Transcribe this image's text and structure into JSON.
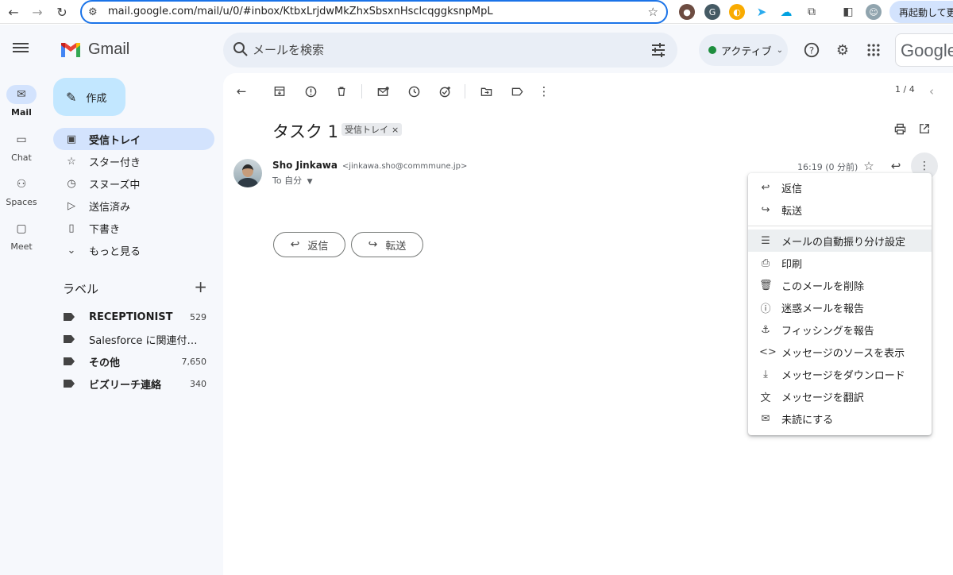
{
  "browser": {
    "url": "mail.google.com/mail/u/0/#inbox/KtbxLrjdwMkZhxSbsxnHsclcqggksnpMpL",
    "restart_label": "再起動して更新"
  },
  "rail": [
    {
      "label": "Mail",
      "icon": "mail-icon"
    },
    {
      "label": "Chat",
      "icon": "chat-icon"
    },
    {
      "label": "Spaces",
      "icon": "spaces-icon"
    },
    {
      "label": "Meet",
      "icon": "meet-icon"
    }
  ],
  "header": {
    "logo_text": "Gmail",
    "search_placeholder": "メールを検索",
    "status": "アクティブ",
    "account_brand": "Google"
  },
  "sidebar": {
    "compose": "作成",
    "items": [
      {
        "label": "受信トレイ",
        "icon": "inbox-icon"
      },
      {
        "label": "スター付き",
        "icon": "star-icon"
      },
      {
        "label": "スヌーズ中",
        "icon": "clock-icon"
      },
      {
        "label": "送信済み",
        "icon": "send-icon"
      },
      {
        "label": "下書き",
        "icon": "draft-icon"
      },
      {
        "label": "もっと見る",
        "icon": "expand-icon"
      }
    ],
    "labels_title": "ラベル",
    "labels": [
      {
        "name": "RECEPTIONIST",
        "count": "529"
      },
      {
        "name": "Salesforce に関連付けら…",
        "count": ""
      },
      {
        "name": "その他",
        "count": "7,650"
      },
      {
        "name": "ビズリーチ連絡",
        "count": "340"
      }
    ]
  },
  "message": {
    "pager": "1 / 4",
    "subject": "タスク 1",
    "chip": "受信トレイ",
    "chip_close": "×",
    "sender_name": "Sho Jinkawa",
    "sender_email": "<jinkawa.sho@commmune.jp>",
    "to": "To 自分",
    "time": "16:19 (0 分前)",
    "reply_button": "返信",
    "forward_button": "転送"
  },
  "menu": {
    "items": [
      {
        "label": "返信",
        "icon": "reply-icon"
      },
      {
        "label": "転送",
        "icon": "forward-icon"
      },
      {
        "label": "メールの自動振り分け設定",
        "icon": "filter-icon"
      },
      {
        "label": "印刷",
        "icon": "print-icon"
      },
      {
        "label": "このメールを削除",
        "icon": "trash-icon"
      },
      {
        "label": "迷惑メールを報告",
        "icon": "spam-icon"
      },
      {
        "label": "フィッシングを報告",
        "icon": "phishing-icon"
      },
      {
        "label": "メッセージのソースを表示",
        "icon": "code-icon"
      },
      {
        "label": "メッセージをダウンロード",
        "icon": "download-icon"
      },
      {
        "label": "メッセージを翻訳",
        "icon": "translate-icon"
      },
      {
        "label": "未読にする",
        "icon": "mark-unread-icon"
      }
    ]
  },
  "colors": {
    "accent": "#1a73e8",
    "compose_bg": "#c2e7ff",
    "active_nav": "#d3e3fd",
    "status_green": "#1e8e3e"
  }
}
